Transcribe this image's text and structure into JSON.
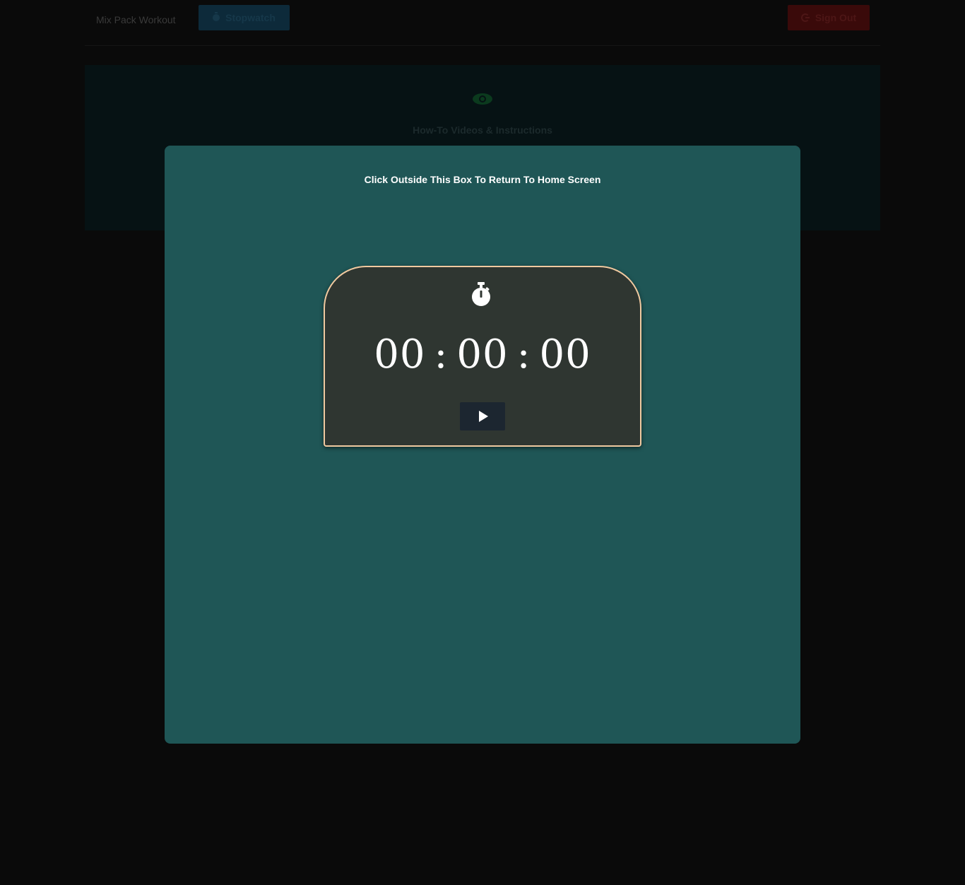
{
  "nav": {
    "brand": "Mix Pack Workout",
    "stopwatch_label": "Stopwatch",
    "signout_label": "Sign Out"
  },
  "howto": {
    "title": "How-To Videos & Instructions"
  },
  "modal": {
    "hint": "Click Outside This Box To Return To Home Screen",
    "timer": {
      "hours": "00",
      "minutes": "00",
      "seconds": "00",
      "separator": ":"
    }
  },
  "colors": {
    "modal_bg": "#1f5656",
    "card_bg": "#2f3631",
    "card_border": "#f0c9a0",
    "page_bg": "#0a0a0a"
  }
}
